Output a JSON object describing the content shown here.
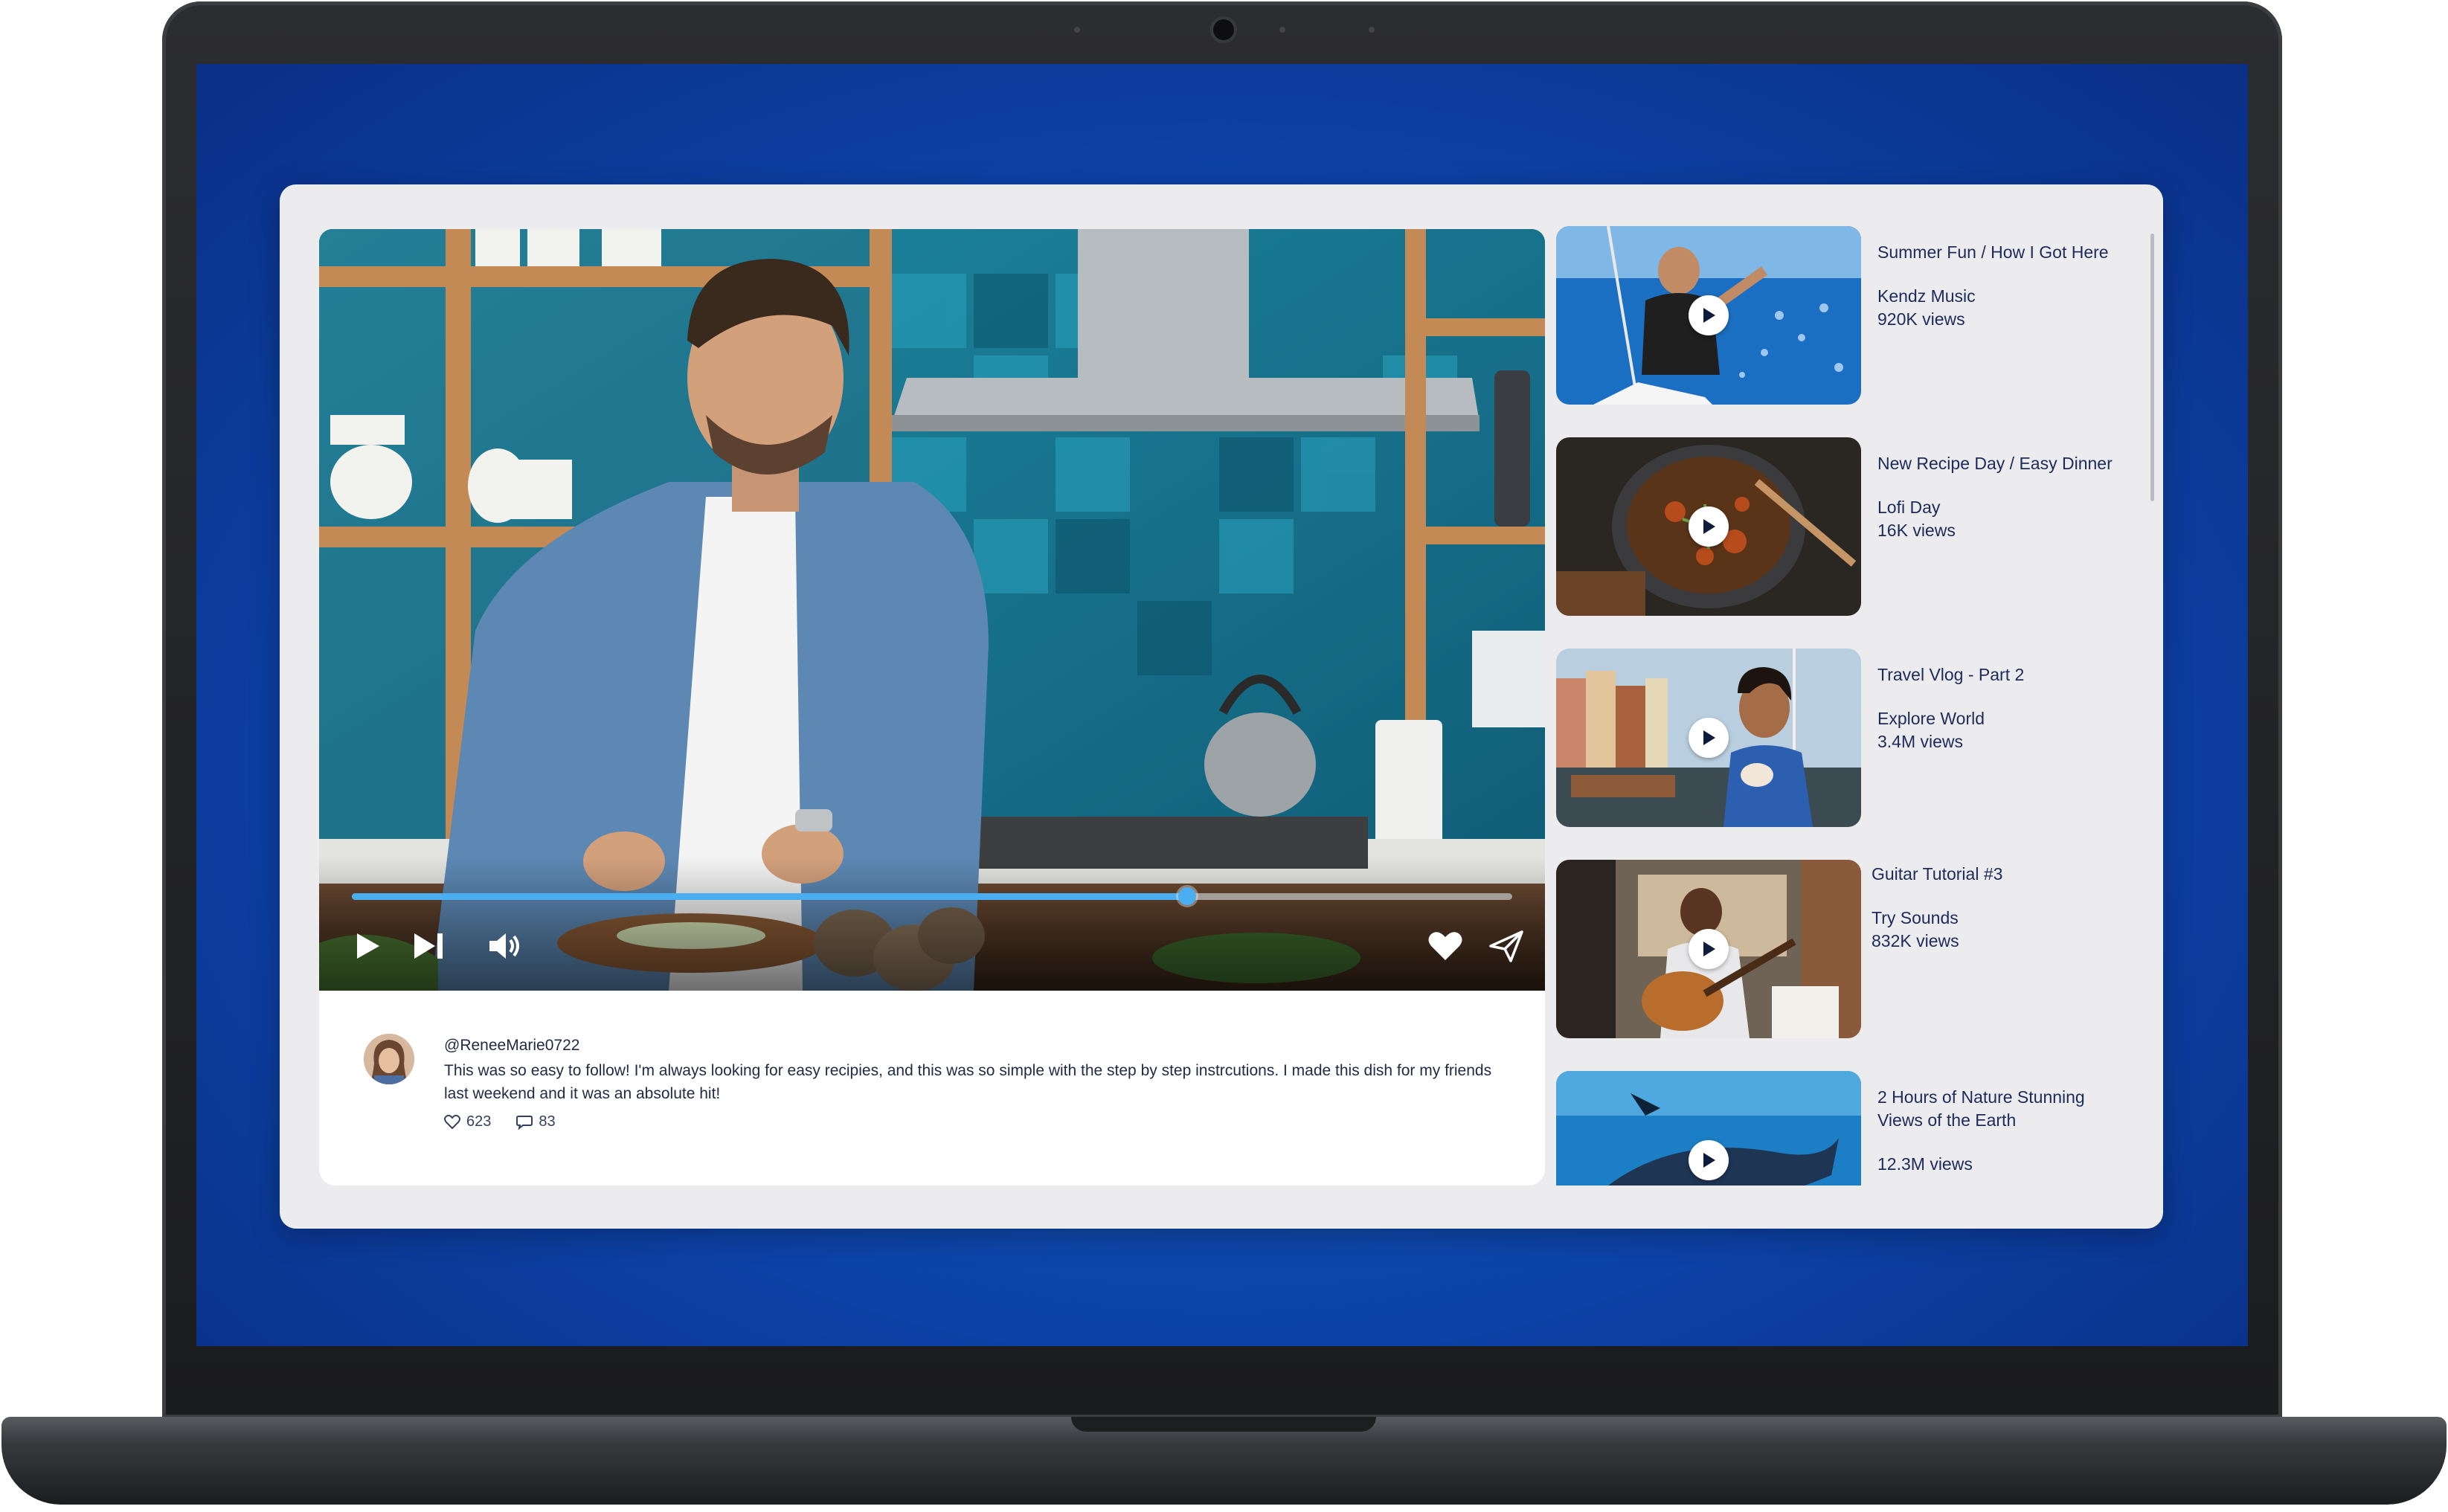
{
  "player": {
    "progress": 0.72,
    "icons": {
      "play": "play-icon",
      "next": "skip-next-icon",
      "volume": "volume-icon",
      "like": "heart-icon",
      "share": "send-icon"
    },
    "colors": {
      "progress": "#4aaef0",
      "accent": "#1c2b5a"
    }
  },
  "comment": {
    "username": "@ReneeMarie0722",
    "text": "This was so easy to follow! I'm always looking for easy recipies, and this was so simple with the step by step instrcutions. I made this dish for my friends last weekend and it was an absolute hit!",
    "likes": "623",
    "replies": "83"
  },
  "up_next": [
    {
      "title": "Summer Fun / How I Got Here",
      "channel": "Kendz Music",
      "views": "920K views"
    },
    {
      "title": "New Recipe Day / Easy Dinner",
      "channel": "Lofi Day",
      "views": "16K views"
    },
    {
      "title": "Travel Vlog - Part 2",
      "channel": "Explore World",
      "views": "3.4M views"
    },
    {
      "title": "Guitar Tutorial #3",
      "channel": "Try Sounds",
      "views": "832K views"
    },
    {
      "title": "2 Hours of Nature Stunning Views of the Earth",
      "channel": "",
      "views": "12.3M views"
    }
  ]
}
